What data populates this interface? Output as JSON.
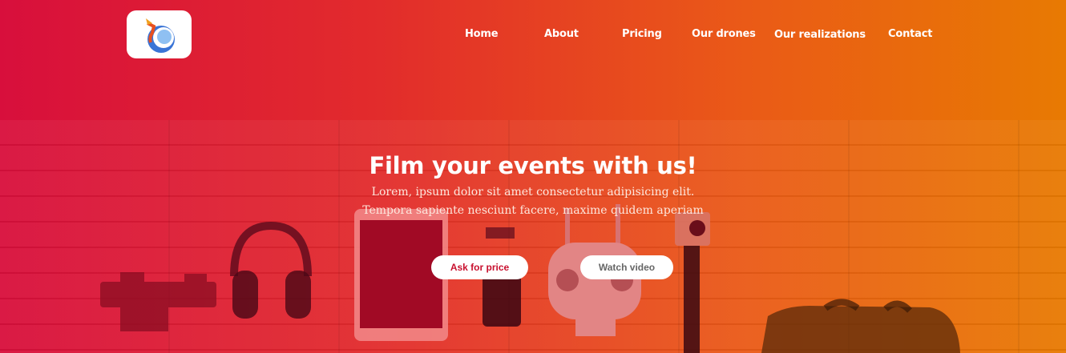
{
  "nav": {
    "items": [
      {
        "label": "Home"
      },
      {
        "label": "About"
      },
      {
        "label": "Pricing"
      },
      {
        "label": "Our drones"
      },
      {
        "label": "Our realizations"
      },
      {
        "label": "Contact"
      }
    ]
  },
  "hero": {
    "title": "Film your events with us!",
    "subtitle": "Lorem, ipsum dolor sit amet consectetur adipisicing elit. Tempora sapiente nesciunt facere, maxime quidem aperiam",
    "primary_button": "Ask for price",
    "secondary_button": "Watch video"
  },
  "colors": {
    "gradient_start": "#d80f3c",
    "gradient_end": "#e87a02",
    "primary_button_text": "#c8102e"
  }
}
